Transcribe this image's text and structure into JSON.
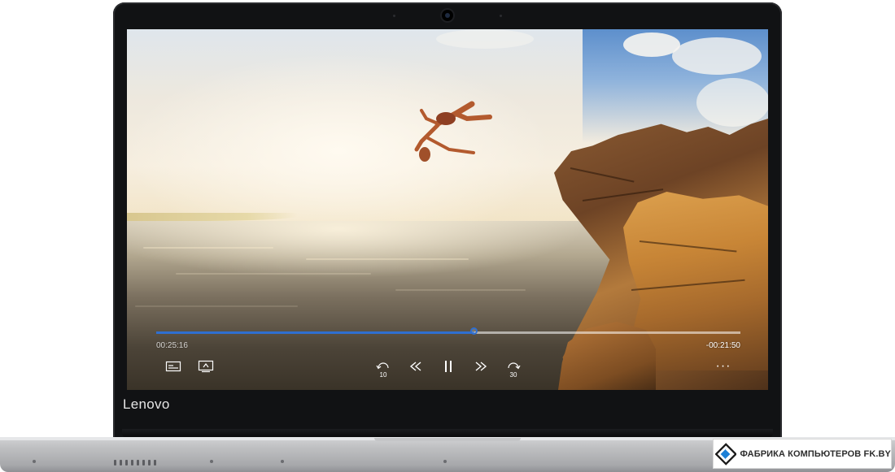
{
  "device": {
    "brand_logo": "Lenovo"
  },
  "player": {
    "elapsed": "00:25:16",
    "remaining": "-00:21:50",
    "progress_fraction": 0.545,
    "skip_back_seconds": "10",
    "skip_forward_seconds": "30",
    "more_label": "···",
    "accent_color": "#2f6fd0"
  },
  "watermark": {
    "text": "ФАБРИКА КОМПЬЮТЕРОВ FK.BY"
  },
  "icons": {
    "captions": "captions-icon",
    "cast": "cast-to-device-icon",
    "skip_back": "skip-back-10-icon",
    "rewind": "rewind-icon",
    "pause": "pause-icon",
    "fast_forward": "fast-forward-icon",
    "skip_forward": "skip-forward-30-icon",
    "more": "more-options-icon"
  }
}
